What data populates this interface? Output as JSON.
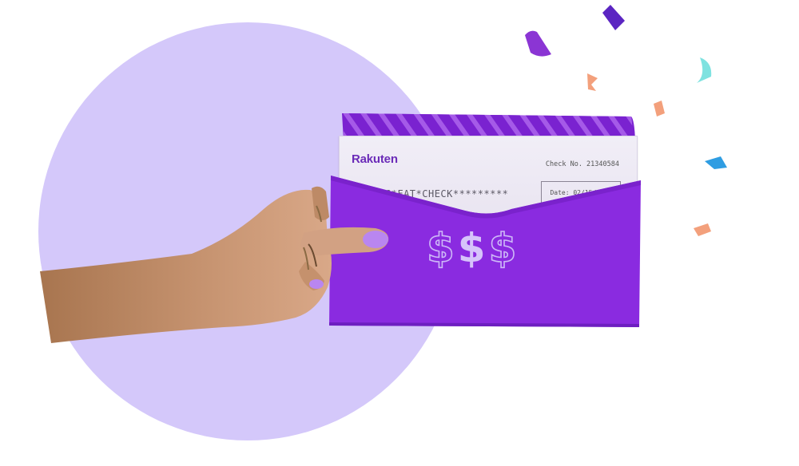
{
  "colors": {
    "circle": "#d4c8fa",
    "envelope": "#8a2be0",
    "envelope_dark": "#6d1fc0",
    "check_text": "#6b2bb8",
    "confetti": [
      "#6a2bd0",
      "#9b3fd8",
      "#f4a07a",
      "#7fe3e0",
      "#2e9be0"
    ]
  },
  "check": {
    "logo": "Rakuten",
    "check_no": "Check No. 21340584",
    "line": "**BIG*FAT*CHECK*********",
    "date": "Date: 02/15/2021"
  },
  "envelope": {
    "symbols": [
      "$",
      "$",
      "$"
    ]
  },
  "icons": {
    "hand": "hand-holding-envelope",
    "confetti": "confetti-pieces"
  }
}
